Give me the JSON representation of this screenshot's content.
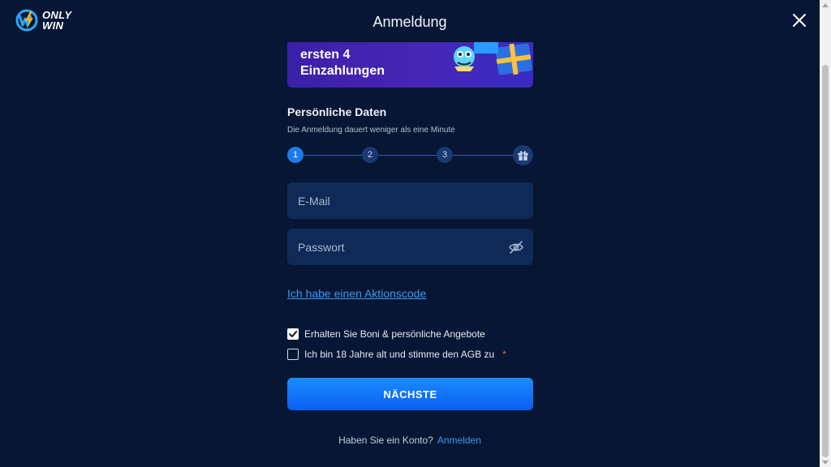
{
  "header": {
    "logo": {
      "line1": "ONLY",
      "line2": "WIN"
    },
    "title": "Anmeldung",
    "close_icon": "close-icon"
  },
  "banner": {
    "line1": "ersten 4",
    "line2": "Einzahlungen"
  },
  "form": {
    "section_title": "Persönliche Daten",
    "section_subtitle": "Die Anmeldung dauert weniger als eine Minute",
    "steps": [
      {
        "label": "1",
        "active": true
      },
      {
        "label": "2",
        "active": false
      },
      {
        "label": "3",
        "active": false
      }
    ],
    "final_step_icon": "gift-icon",
    "email": {
      "value": "",
      "placeholder": "E-Mail"
    },
    "password": {
      "value": "",
      "placeholder": "Passwort",
      "toggle_icon": "eye-off-icon"
    },
    "promo_link": "Ich habe einen Aktionscode",
    "checkboxes": [
      {
        "label": "Erhalten Sie Boni & persönliche Angebote",
        "checked": true,
        "required": false
      },
      {
        "label": "Ich bin 18 Jahre alt und stimme den AGB zu",
        "checked": false,
        "required": true,
        "required_mark": "*"
      }
    ],
    "submit_label": "NÄCHSTE"
  },
  "footer": {
    "question": "Haben Sie ein Konto?",
    "login_link": "Anmelden"
  },
  "colors": {
    "background": "#071634",
    "field_bg": "#102a57",
    "accent": "#1f7be8",
    "link": "#3b9bf5",
    "required": "#ff5a4f"
  }
}
